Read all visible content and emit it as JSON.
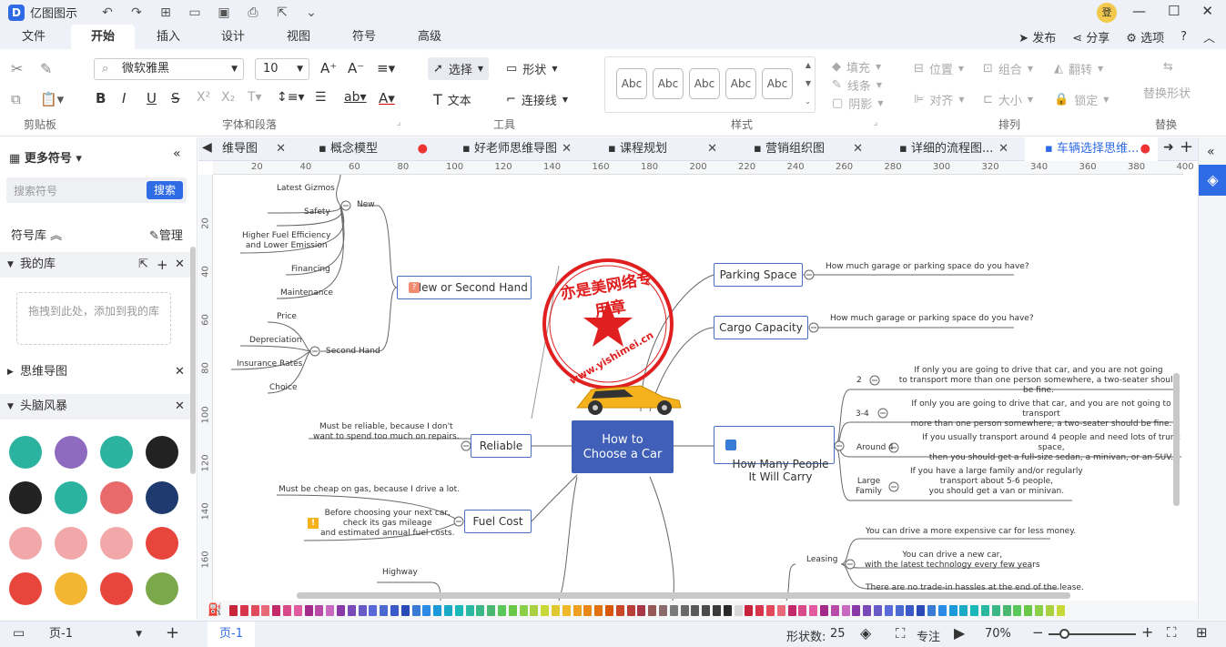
{
  "app": {
    "title": "亿图图示",
    "user_initial": "登"
  },
  "menu": {
    "items": [
      "文件",
      "开始",
      "插入",
      "设计",
      "视图",
      "符号",
      "高级"
    ],
    "active": "开始",
    "right": [
      "发布",
      "分享",
      "选项"
    ]
  },
  "ribbon": {
    "font_name": "微软雅黑",
    "font_size": "10",
    "select_label": "选择",
    "shape_label": "形状",
    "text_label": "文本",
    "connector_label": "连接线",
    "style_sample": "Abc",
    "fill": "填充",
    "line": "线条",
    "shadow": "阴影",
    "position": "位置",
    "group": "组合",
    "flip": "翻转",
    "align": "对齐",
    "size": "大小",
    "lock": "锁定",
    "replace_shape": "替换形状",
    "groups": [
      "剪贴板",
      "字体和段落",
      "工具",
      "样式",
      "排列",
      "替换"
    ]
  },
  "sidebar": {
    "title": "更多符号",
    "search_placeholder": "搜索符号",
    "search_btn": "搜索",
    "library": "符号库",
    "manage": "管理",
    "my_lib": "我的库",
    "drop_hint": "拖拽到此处，添加到我的库",
    "mindmap": "思维导图",
    "brainstorm": "头脑风暴"
  },
  "tabs": [
    "维导图",
    "概念模型",
    "好老师思维导图",
    "课程规划",
    "营销组织图",
    "详细的流程图...",
    "车辆选择思维..."
  ],
  "ruler": {
    "h": [
      "20",
      "40",
      "60",
      "80",
      "100",
      "120",
      "140",
      "160",
      "180",
      "200",
      "220",
      "240",
      "260",
      "280",
      "300",
      "320",
      "340",
      "360",
      "380",
      "400"
    ],
    "v": [
      "20",
      "40",
      "60",
      "80",
      "100",
      "120",
      "140",
      "160"
    ]
  },
  "mindmap": {
    "center": "How to\nChoose a Car",
    "stamp_text": "亦是美网络专用章",
    "stamp_url": "www.yishimei.cn",
    "branches": {
      "new_second": "New or Second Hand",
      "new": "New",
      "new_items": [
        "Latest Gizmos",
        "Safety",
        "Higher Fuel Efficiency\nand Lower Emission",
        "Financing",
        "Maintenance"
      ],
      "second": "Second Hand",
      "second_items": [
        "Price",
        "Depreciation",
        "Insurance Rates",
        "Choice"
      ],
      "reliable": "Reliable",
      "reliable_note": "Must be reliable, because I don't\nwant to spend too much on repairs.",
      "fuel": "Fuel Cost",
      "fuel_note1": "Must be cheap on gas, because I drive a lot.",
      "fuel_note2": "Before choosing your next car,\ncheck its gas mileage\nand estimated annual fuel costs.",
      "highway": "Highway",
      "parking": "Parking Space",
      "parking_note": "How much garage or parking space do you have?",
      "cargo": "Cargo Capacity",
      "cargo_note": "How much garage or parking space do you have?",
      "people": "How Many People\nIt Will Carry",
      "people_items": [
        {
          "k": "2",
          "v": "If only you are going to drive that car, and you are not going\nto transport more than one person somewhere, a two-seater should be fine."
        },
        {
          "k": "3-4",
          "v": "If only you are going to drive that car, and you are not going to transport\nmore than one person somewhere, a two-seater should be fine."
        },
        {
          "k": "Around 4",
          "v": "If you usually transport around 4 people and need lots of trunk space,\nthen you should get a full-size sedan, a minivan, or an SUV."
        },
        {
          "k": "Large\nFamily",
          "v": "If you have a large family and/or regularly\ntransport about 5-6 people,\nyou should get a van or minivan."
        }
      ],
      "leasing": "Leasing",
      "leasing_items": [
        "You can drive a more expensive car for less money.",
        "You can drive a new car,\nwith the latest technology every few years",
        "There are no trade-in hassles at the end of the lease."
      ]
    }
  },
  "status": {
    "page": "页-1",
    "page_tab": "页-1",
    "shape_count_label": "形状数:",
    "shape_count": "25",
    "focus": "专注",
    "zoom": "70%"
  },
  "colors": {
    "accent": "#2f6be5",
    "node_center": "#3f5fb8",
    "stamp": "#e02020"
  }
}
